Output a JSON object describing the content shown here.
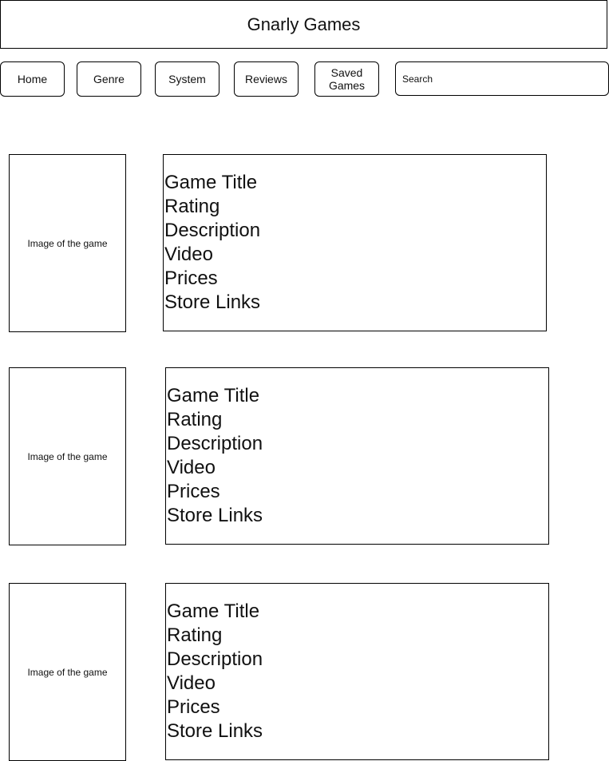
{
  "header": {
    "title": "Gnarly Games"
  },
  "nav": {
    "buttons": [
      {
        "label": "Home"
      },
      {
        "label": "Genre"
      },
      {
        "label": "System"
      },
      {
        "label": "Reviews"
      },
      {
        "label": "Saved\nGames"
      }
    ],
    "search_placeholder": "Search"
  },
  "games": [
    {
      "image_label": "Image of the game",
      "fields": [
        "Game Title",
        "Rating",
        "Description",
        "Video",
        "Prices",
        "Store Links"
      ]
    },
    {
      "image_label": "Image of the game",
      "fields": [
        "Game Title",
        "Rating",
        "Description",
        "Video",
        "Prices",
        "Store Links"
      ]
    },
    {
      "image_label": "Image of the game",
      "fields": [
        "Game Title",
        "Rating",
        "Description",
        "Video",
        "Prices",
        "Store Links"
      ]
    }
  ]
}
